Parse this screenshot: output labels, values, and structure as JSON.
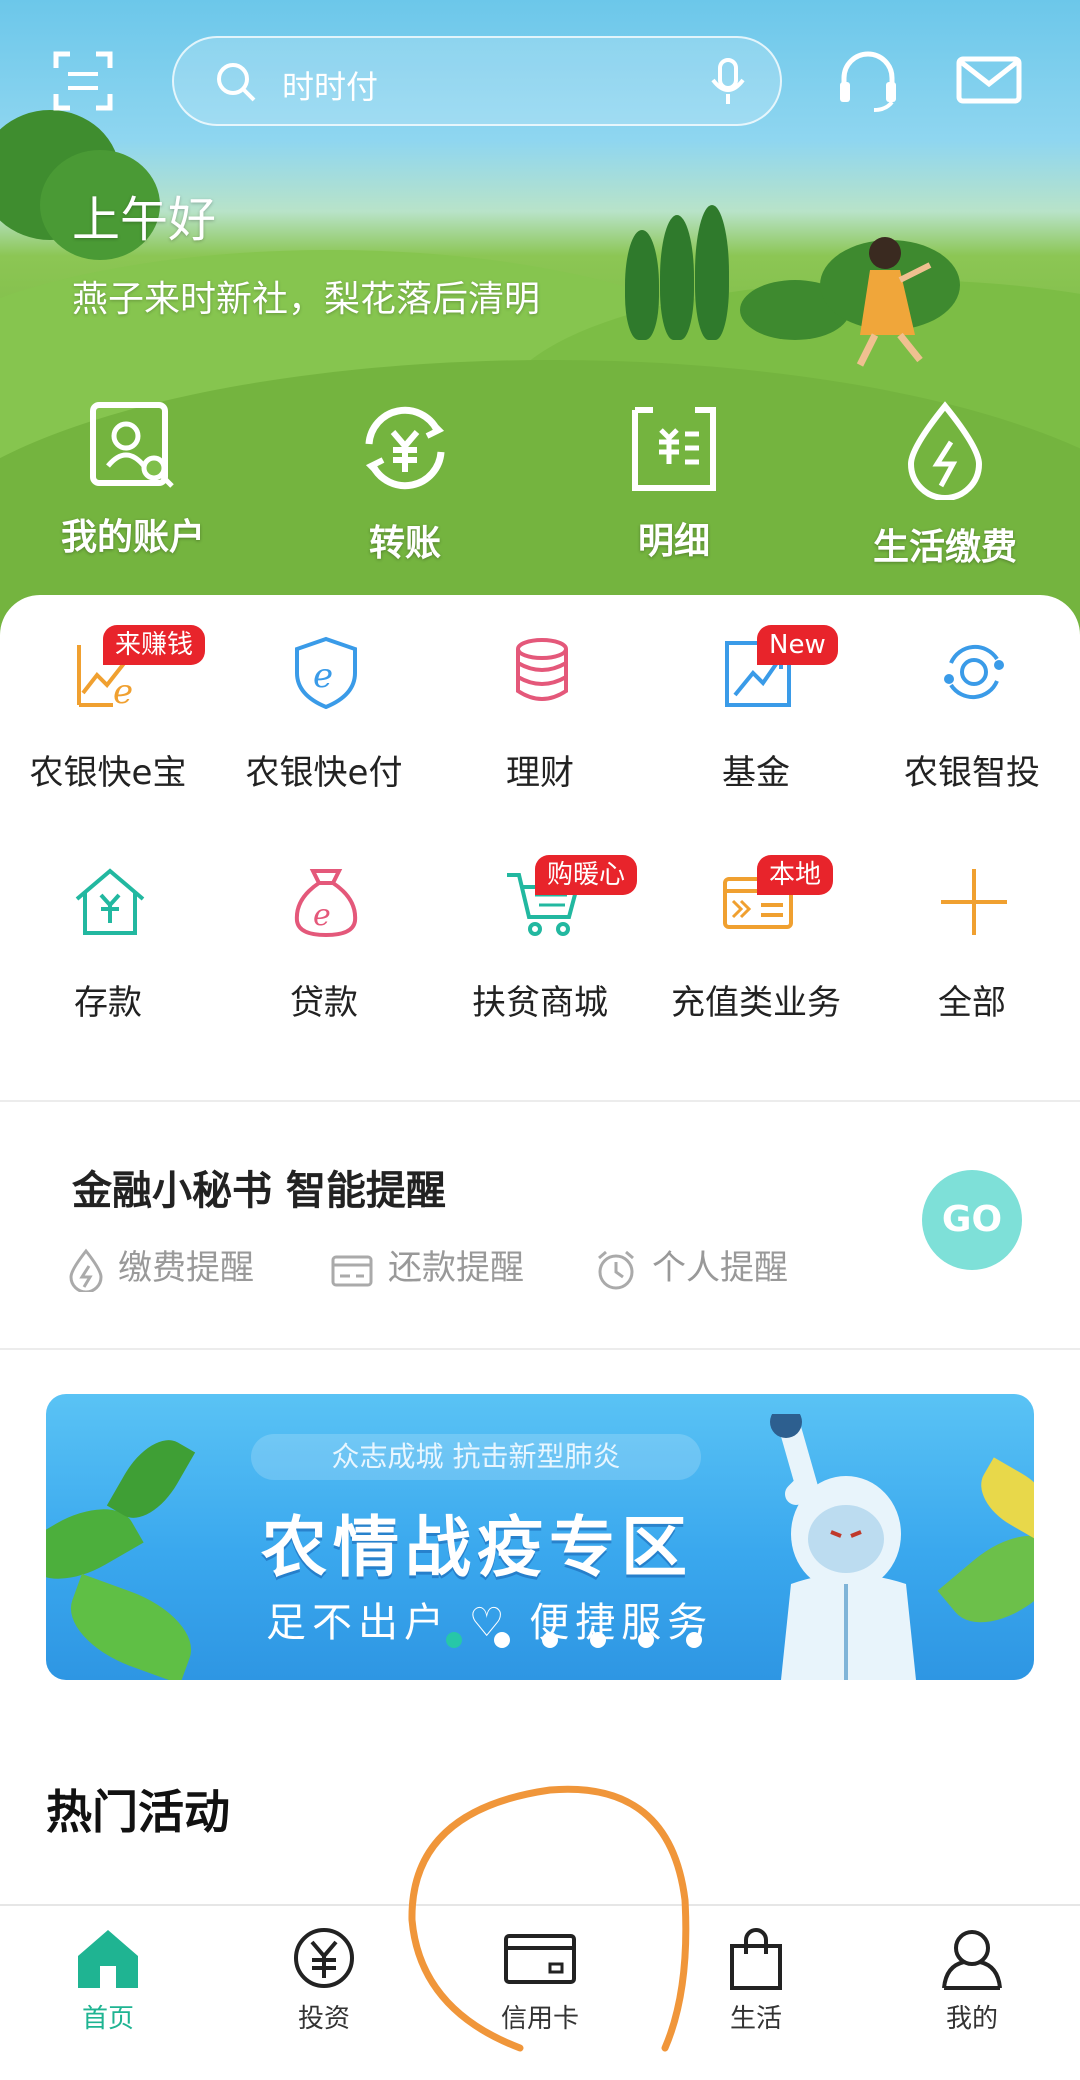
{
  "header": {
    "search_placeholder": "时时付",
    "greeting": "上午好",
    "poem": "燕子来时新社，梨花落后清明"
  },
  "quick_actions": [
    {
      "label": "我的账户",
      "icon": "account-search-icon"
    },
    {
      "label": "转账",
      "icon": "transfer-yuan-icon"
    },
    {
      "label": "明细",
      "icon": "details-list-icon"
    },
    {
      "label": "生活缴费",
      "icon": "utility-drop-icon"
    }
  ],
  "services": [
    {
      "label": "农银快e宝",
      "badge": "来赚钱",
      "icon": "chart-e-icon"
    },
    {
      "label": "农银快e付",
      "badge": "",
      "icon": "shield-e-icon"
    },
    {
      "label": "理财",
      "badge": "",
      "icon": "coin-stack-icon"
    },
    {
      "label": "基金",
      "badge": "New",
      "icon": "fund-chart-icon"
    },
    {
      "label": "农银智投",
      "badge": "",
      "icon": "smart-invest-icon"
    },
    {
      "label": "存款",
      "badge": "",
      "icon": "deposit-house-icon"
    },
    {
      "label": "贷款",
      "badge": "",
      "icon": "loan-bag-icon"
    },
    {
      "label": "扶贫商城",
      "badge": "购暖心",
      "icon": "shopping-cart-icon"
    },
    {
      "label": "充值类业务",
      "badge": "本地",
      "icon": "recharge-card-icon"
    },
    {
      "label": "全部",
      "badge": "",
      "icon": "plus-icon"
    }
  ],
  "secretary": {
    "title": "金融小秘书 智能提醒",
    "reminders": [
      {
        "label": "缴费提醒",
        "icon": "bolt-drop-icon"
      },
      {
        "label": "还款提醒",
        "icon": "card-icon"
      },
      {
        "label": "个人提醒",
        "icon": "alarm-clock-icon"
      }
    ],
    "go_label": "GO"
  },
  "banner": {
    "top_line": "众志成城 抗击新型肺炎",
    "title": "农情战疫专区",
    "subtitle": "足不出户 ♡ 便捷服务",
    "slide_count": 6,
    "active_slide": 1
  },
  "hot_activities_title": "热门活动",
  "tabbar": [
    {
      "label": "首页",
      "icon": "home-icon",
      "active": true
    },
    {
      "label": "投资",
      "icon": "yuan-circle-icon",
      "active": false
    },
    {
      "label": "信用卡",
      "icon": "credit-card-icon",
      "active": false
    },
    {
      "label": "生活",
      "icon": "shopping-bag-icon",
      "active": false
    },
    {
      "label": "我的",
      "icon": "person-icon",
      "active": false
    }
  ],
  "colors": {
    "accent": "#1fb492",
    "badge_red": "#e8242b",
    "orange_icon": "#f0a030",
    "blue_icon": "#3a9be8",
    "pink_icon": "#e4587a",
    "teal_icon": "#22b8a0",
    "annotation_orange": "#f0963a"
  }
}
